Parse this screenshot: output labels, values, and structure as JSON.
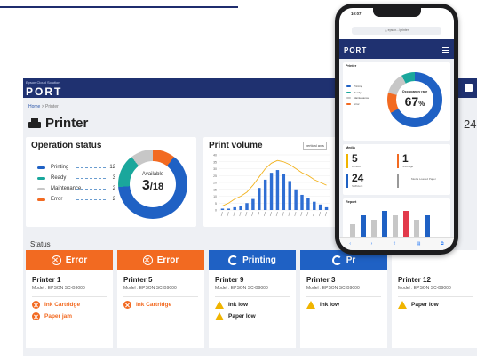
{
  "app": {
    "brand_small": "Epson Cloud Solution",
    "brand": "PORT",
    "breadcrumb_home": "Home",
    "breadcrumb_current": "> Printer",
    "page_title": "Printer",
    "edge_number": "24"
  },
  "operation_status": {
    "title": "Operation status",
    "legend": [
      {
        "name": "Printing",
        "count": "12",
        "color": "#1f61c4"
      },
      {
        "name": "Ready",
        "count": "3",
        "color": "#1aa79c"
      },
      {
        "name": "Maintenance",
        "count": "2",
        "color": "#c7c7c7"
      },
      {
        "name": "Error",
        "count": "2",
        "color": "#f26a21"
      }
    ],
    "donut_label": "Available",
    "available": "3",
    "total": "/18"
  },
  "print_volume": {
    "title": "Print volume",
    "selector": "vertical axis",
    "chart_data": {
      "type": "bar",
      "title": "Print volume",
      "ylim": [
        0,
        40
      ],
      "yticks": [
        "40",
        "35",
        "30",
        "25",
        "20",
        "15",
        "10",
        "5",
        "0"
      ],
      "values": [
        1,
        1,
        2,
        3,
        5,
        8,
        16,
        22,
        27,
        29,
        26,
        21,
        15,
        11,
        9,
        6,
        4,
        2
      ],
      "line_values": [
        3,
        5,
        8,
        10,
        13,
        18,
        24,
        30,
        34,
        36,
        35,
        33,
        30,
        27,
        25,
        22,
        20,
        18
      ],
      "bar_color": "#2f6ed3",
      "line_color": "#f2b21c"
    }
  },
  "status_label": "Status",
  "printers": [
    {
      "banner": "Error",
      "state": "err",
      "name": "Printer 1",
      "model": "Model : EPSON SC-B9000",
      "issues": [
        {
          "type": "err",
          "text": "Ink Cartridge"
        },
        {
          "type": "err",
          "text": "Paper jam"
        }
      ]
    },
    {
      "banner": "Error",
      "state": "err",
      "name": "Printer 5",
      "model": "Model : EPSON SC-B9000",
      "issues": [
        {
          "type": "err",
          "text": "Ink Cartridge"
        }
      ]
    },
    {
      "banner": "Printing",
      "state": "prt",
      "name": "Printer 9",
      "model": "Model : EPSON SC-B9000",
      "issues": [
        {
          "type": "warn",
          "text": "Ink low"
        },
        {
          "type": "warn",
          "text": "Paper low"
        }
      ]
    },
    {
      "banner": "Pr",
      "state": "prt",
      "name": "Printer 3",
      "model": "Model : EPSON SC-B9000",
      "issues": [
        {
          "type": "warn",
          "text": "Ink low"
        }
      ]
    },
    {
      "banner": "",
      "state": "",
      "name": "Printer 12",
      "model": "Model : EPSON SC-B9000",
      "issues": [
        {
          "type": "warn",
          "text": "Paper low"
        }
      ]
    }
  ],
  "phone": {
    "time": "10:07",
    "url": "△ epson.../printer",
    "brand": "PORT",
    "printer_title": "Printer",
    "legend": [
      "Printing",
      "Ready",
      "Maintenance",
      "Error"
    ],
    "donut_label": "Occupancy rate",
    "occupancy": "67",
    "occupancy_unit": "%",
    "media_title": "Media",
    "media": [
      {
        "value": "5",
        "label": "Limited",
        "color": "#f0b400"
      },
      {
        "value": "1",
        "label": "Shortage",
        "color": "#f26a21"
      },
      {
        "value": "24",
        "label": "Sufficient",
        "color": "#1f61c4"
      },
      {
        "value": "",
        "label": "Media Loaded Paper",
        "color": "#999999"
      }
    ],
    "report_title": "Report",
    "report_chart": {
      "type": "bar",
      "values": [
        3,
        5,
        4,
        6,
        5,
        6,
        4,
        5
      ],
      "colors": [
        "#c7c7c7",
        "#1f61c4",
        "#c7c7c7",
        "#1f61c4",
        "#c7c7c7",
        "#e23a4b",
        "#c7c7c7",
        "#1f61c4"
      ]
    }
  }
}
